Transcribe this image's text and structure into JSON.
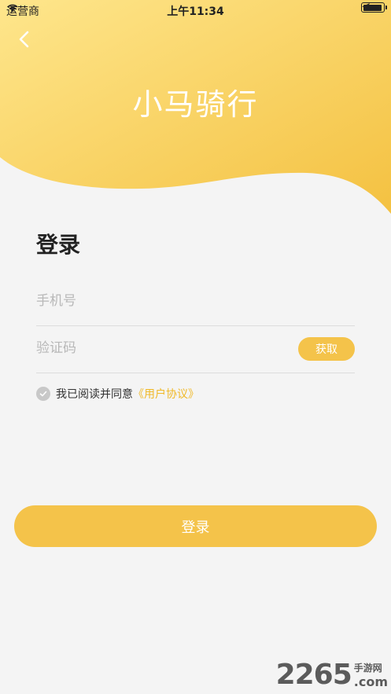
{
  "status_bar": {
    "carrier": "运营商",
    "time": "上午11:34",
    "battery_level": 0.95
  },
  "header": {
    "back_icon": "chevron-left-icon",
    "app_title": "小马骑行"
  },
  "login": {
    "heading": "登录",
    "phone_placeholder": "手机号",
    "code_placeholder": "验证码",
    "get_code_label": "获取",
    "agree_text": "我已阅读并同意",
    "agreement_link": "《用户协议》",
    "submit_label": "登录"
  },
  "watermark": {
    "number": "2265",
    "cn": "手游网",
    "domain": ".com"
  },
  "colors": {
    "accent": "#f4c34a",
    "header_light": "#fde68c",
    "header_dark": "#f5c445",
    "background": "#f4f4f4"
  }
}
